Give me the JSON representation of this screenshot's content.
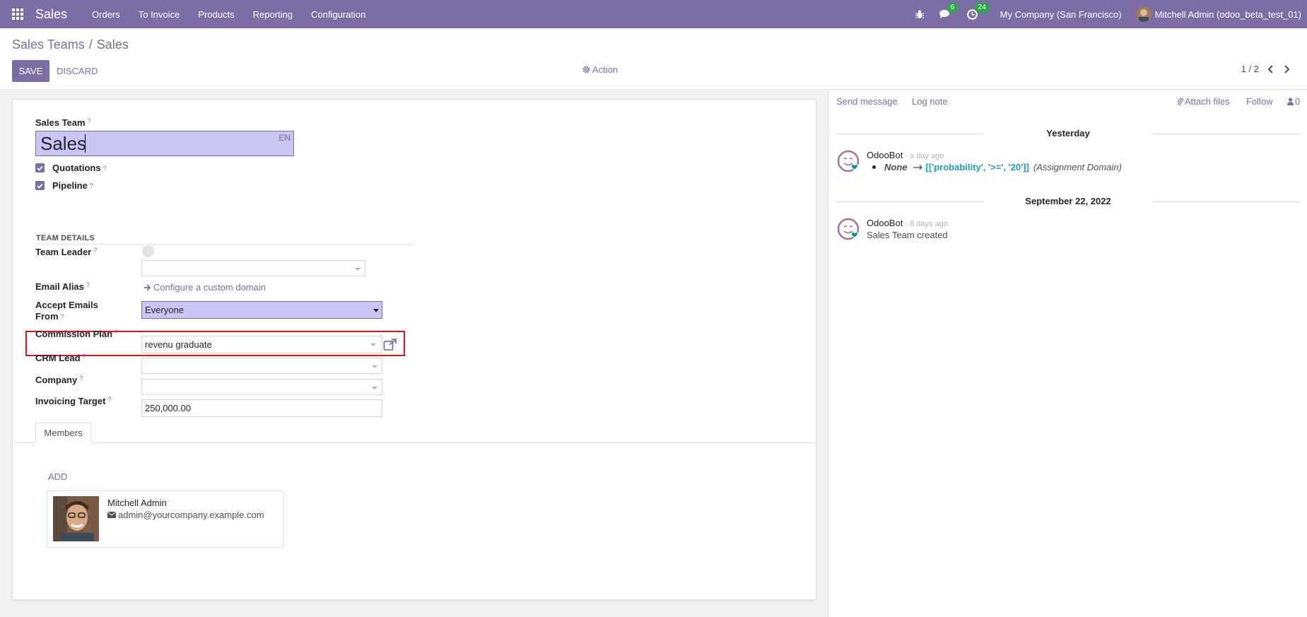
{
  "navbar": {
    "brand": "Sales",
    "menu": [
      "Orders",
      "To Invoice",
      "Products",
      "Reporting",
      "Configuration"
    ],
    "messages_count": "6",
    "activities_count": "24",
    "company": "My Company (San Francisco)",
    "user": "Mitchell Admin (odoo_beta_test_01)"
  },
  "control": {
    "breadcrumb_parent": "Sales Teams",
    "breadcrumb_sep": "/",
    "breadcrumb_current": "Sales",
    "save_label": "SAVE",
    "discard_label": "DISCARD",
    "action_label": "Action",
    "pager": "1 / 2"
  },
  "form": {
    "team_label": "Sales Team",
    "team_name": "Sales",
    "lang": "EN",
    "quotations_label": "Quotations",
    "pipeline_label": "Pipeline",
    "section_title": "TEAM DETAILS",
    "team_leader_label": "Team Leader",
    "email_alias_label": "Email Alias",
    "configure_domain": "Configure a custom domain",
    "accept_emails_label_1": "Accept Emails",
    "accept_emails_label_2": "From",
    "accept_emails_value": "Everyone",
    "commission_plan_label": "Commission Plan",
    "commission_plan_value": "revenu graduate",
    "crm_lead_label": "CRM Lead",
    "company_label": "Company",
    "invoicing_target_label": "Invoicing Target",
    "invoicing_target_value": "250,000.00",
    "question_mark": "?"
  },
  "tabs": {
    "members_label": "Members",
    "add_label": "ADD"
  },
  "member": {
    "name": "Mitchell Admin",
    "email": "admin@yourcompany.example.com"
  },
  "chatter": {
    "send_message": "Send message",
    "log_note": "Log note",
    "attach_files": "Attach files",
    "follow": "Follow",
    "followers_count": "0",
    "messages": [
      {
        "date": "Yesterday",
        "author": "OdooBot",
        "time": " - a day ago",
        "old_value": "None",
        "new_value": "[['probability', '>=', '20']]",
        "field": "(Assignment Domain)"
      },
      {
        "date": "September 22, 2022",
        "author": "OdooBot",
        "time": " - 8 days ago",
        "body": "Sales Team created"
      }
    ]
  },
  "colors": {
    "brand": "#7c6ea5",
    "highlight": "#e3131e",
    "badge": "#28a745",
    "tracking": "#17a2b8"
  }
}
